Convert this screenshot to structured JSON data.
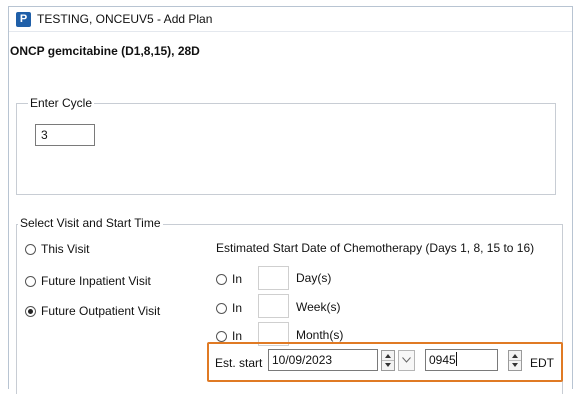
{
  "window": {
    "app_icon_letter": "P",
    "title": "TESTING, ONCEUV5 - Add Plan"
  },
  "plan": {
    "name": "ONCP gemcitabine (D1,8,15), 28D"
  },
  "enter_cycle": {
    "legend": "Enter Cycle",
    "value": "3"
  },
  "visit": {
    "legend": "Select Visit and Start Time",
    "options": [
      {
        "label": "This Visit",
        "checked": false
      },
      {
        "label": "Future Inpatient Visit",
        "checked": false
      },
      {
        "label": "Future Outpatient Visit",
        "checked": true
      }
    ]
  },
  "start_date": {
    "heading": "Estimated Start Date of Chemotherapy (Days 1, 8, 15 to 16)",
    "rows": [
      {
        "radio_label": "In",
        "unit": "Day(s)"
      },
      {
        "radio_label": "In",
        "unit": "Week(s)"
      },
      {
        "radio_label": "In",
        "unit": "Month(s)"
      }
    ],
    "est_start_label": "Est. start",
    "date_value": "10/09/2023",
    "time_value": "0945",
    "timezone": "EDT"
  },
  "colors": {
    "highlight": "#e07a24",
    "app_icon": "#1f5fa8"
  }
}
